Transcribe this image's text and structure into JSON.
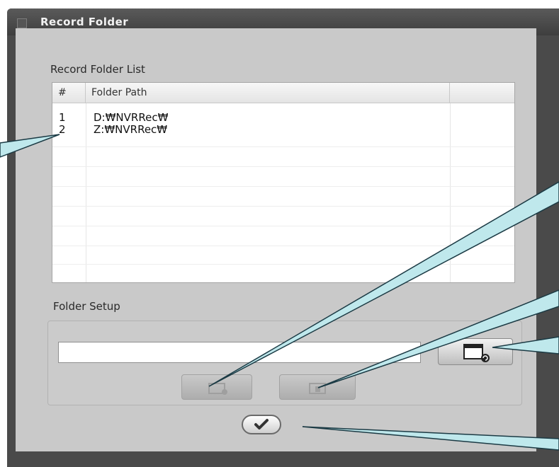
{
  "window": {
    "title": "Record Folder"
  },
  "record_list": {
    "label": "Record Folder List",
    "columns": [
      "#",
      "Folder Path",
      ""
    ],
    "rows": [
      {
        "num": "1",
        "path": "D:₩NVRRec₩"
      },
      {
        "num": "2",
        "path": "Z:₩NVRRec₩"
      }
    ]
  },
  "folder_setup": {
    "label": "Folder Setup",
    "path_value": "",
    "add_button_icon": "add-folder-icon",
    "delete_button_icon": "remove-folder-icon",
    "browse_button_icon": "browse-folder-icon"
  },
  "footer": {
    "ok_button_icon": "checkmark-icon"
  },
  "colors": {
    "window_bg": "#4a4a4a",
    "panel_bg": "#c9c9c9",
    "callout_fill": "#bfe8ec",
    "callout_stroke": "#1b3a44"
  }
}
